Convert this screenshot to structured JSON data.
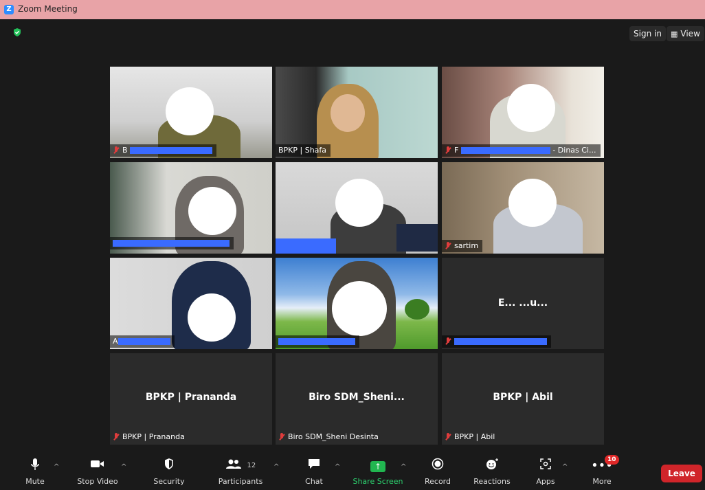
{
  "window": {
    "title": "Zoom Meeting"
  },
  "topbar": {
    "sign_in": "Sign in",
    "view": "View"
  },
  "tiles": [
    {
      "name": "B",
      "muted": true
    },
    {
      "name": "BPKP | Shafa",
      "muted": false
    },
    {
      "name": "F",
      "suffix": "- Dinas Ci...",
      "muted": true
    },
    {
      "name": "",
      "muted": false,
      "active": true
    },
    {
      "name": "",
      "muted": false
    },
    {
      "name": "sartim",
      "muted": true
    },
    {
      "name": "A",
      "muted": false
    },
    {
      "name": "",
      "muted": false
    },
    {
      "center": "E... ...u...",
      "name": "",
      "muted": true
    },
    {
      "center": "BPKP | Pranan­da",
      "name": "BPKP | Prananda",
      "muted": true
    },
    {
      "center": "Biro  SDM_Sheni...",
      "name": "Biro SDM_Sheni Desinta",
      "muted": true
    },
    {
      "center": "BPKP | Abil",
      "name": "BPKP | Abil",
      "muted": true
    }
  ],
  "toolbar": {
    "mute": "Mute",
    "stop_video": "Stop Video",
    "security": "Security",
    "participants": "Participants",
    "participants_count": "12",
    "chat": "Chat",
    "share_screen": "Share Screen",
    "record": "Record",
    "reactions": "Reactions",
    "apps": "Apps",
    "more": "More",
    "more_badge": "10",
    "leave": "Leave"
  },
  "colors": {
    "active_border": "#d7e27a",
    "share_green": "#21b650",
    "leave_red": "#d0252a",
    "muted_red": "#e03c3c"
  }
}
